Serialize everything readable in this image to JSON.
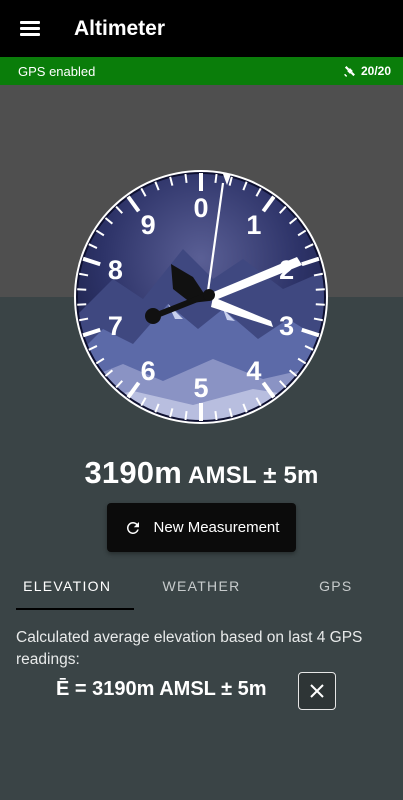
{
  "app_bar": {
    "title": "Altimeter",
    "menu_icon": "hamburger-menu-icon"
  },
  "status_bar": {
    "gps_status": "GPS enabled",
    "satellite_icon": "satellite-icon",
    "satellites": "20/20",
    "color": "#0a7d0a"
  },
  "gauge": {
    "dial_numbers": [
      "0",
      "1",
      "2",
      "3",
      "4",
      "5",
      "6",
      "7",
      "8",
      "9"
    ],
    "theme": "mountain-night",
    "reading_m": 3190
  },
  "readout": {
    "value": "3190m",
    "suffix": " AMSL ± 5m"
  },
  "measure_button": {
    "label": "New Measurement",
    "icon": "refresh-icon"
  },
  "tabs": [
    {
      "label": "ELEVATION",
      "active": true
    },
    {
      "label": "WEATHER",
      "active": false
    },
    {
      "label": "GPS",
      "active": false
    }
  ],
  "elevation": {
    "description": "Calculated average elevation based on last 4 GPS readings:",
    "average": "Ē = 3190m AMSL ± 5m",
    "close_icon": "close-icon"
  }
}
